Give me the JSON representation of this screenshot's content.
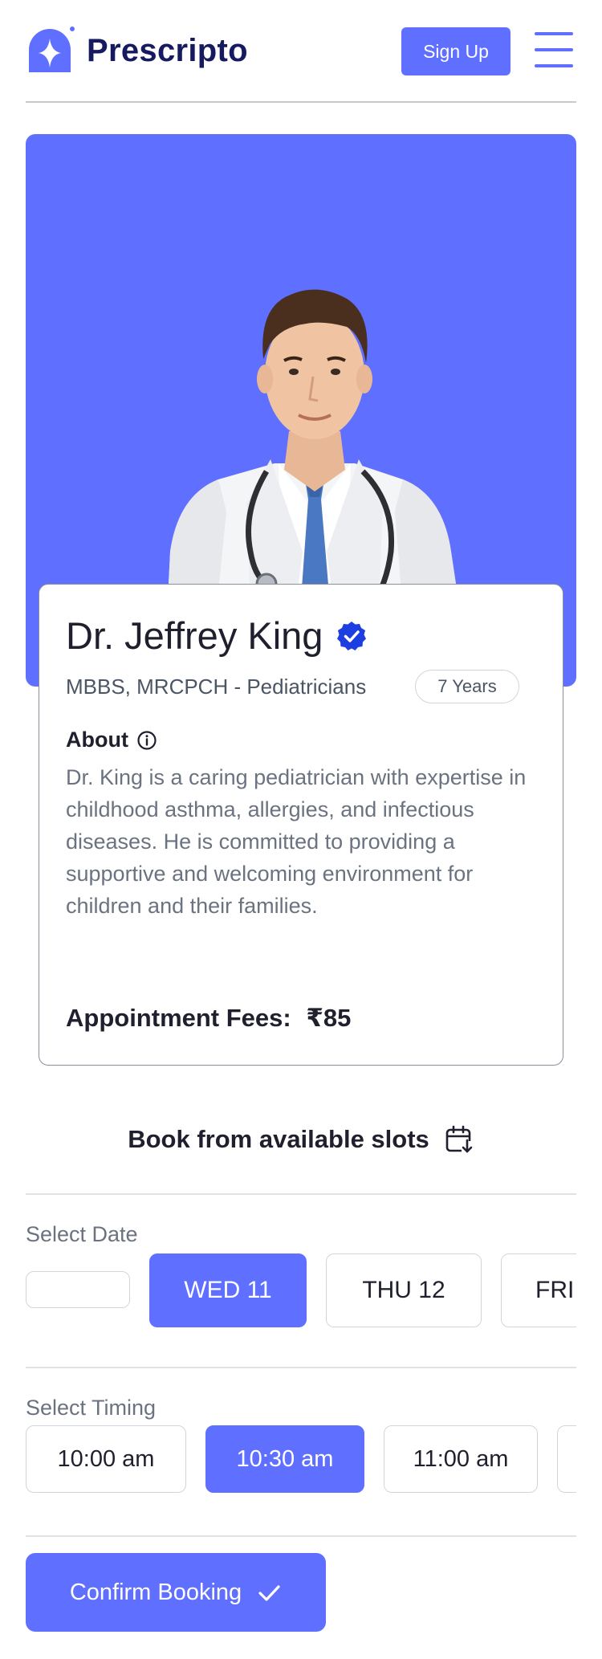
{
  "header": {
    "logo_text": "Prescripto",
    "signup_label": "Sign Up"
  },
  "doctor": {
    "name": "Dr. Jeffrey King",
    "degree": "MBBS, MRCPCH - Pediatricians",
    "experience": "7 Years",
    "about_title": "About",
    "about_text": "Dr. King is a caring pediatrician with expertise in childhood asthma, allergies, and infectious diseases. He is committed to providing a supportive and welcoming environment for children and their families.",
    "fees_label": "Appointment Fees:",
    "fees_value": "₹85"
  },
  "booking": {
    "title": "Book from available slots",
    "date_label": "Select Date",
    "dates": [
      {
        "label": ""
      },
      {
        "label": "WED  11"
      },
      {
        "label": "THU  12"
      },
      {
        "label": "FRI"
      }
    ],
    "timing_label": "Select Timing",
    "times": [
      {
        "label": "10:00 am"
      },
      {
        "label": "10:30 am"
      },
      {
        "label": "11:00 am"
      },
      {
        "label": ""
      }
    ],
    "confirm_label": "Confirm Booking"
  },
  "colors": {
    "accent": "#5f6fff",
    "brand_dark": "#161a5e",
    "verified": "#1d3ee0"
  },
  "icons": {
    "logo": "prescripto-logo-icon",
    "menu": "hamburger-menu-icon",
    "verified": "verified-badge-icon",
    "info": "info-icon",
    "calendar": "calendar-arrow-icon",
    "check": "checkmark-icon"
  }
}
